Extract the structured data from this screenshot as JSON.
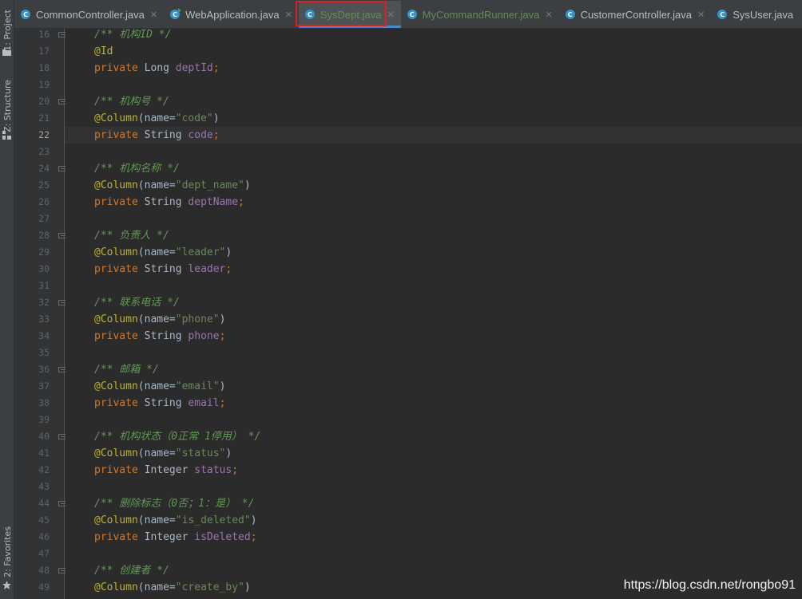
{
  "tool_windows": {
    "project": "1: Project",
    "structure": "Z: Structure",
    "favorites": "2: Favorites"
  },
  "tabs": [
    {
      "label": "CommonController.java",
      "icon": "class-icon",
      "state": "normal"
    },
    {
      "label": "WebApplication.java",
      "icon": "runnable-class-icon",
      "state": "normal"
    },
    {
      "label": "SysDept.java",
      "icon": "class-icon",
      "state": "active"
    },
    {
      "label": "MyCommandRunner.java",
      "icon": "class-icon",
      "state": "green"
    },
    {
      "label": "CustomerController.java",
      "icon": "class-icon",
      "state": "normal"
    },
    {
      "label": "SysUser.java",
      "icon": "class-icon",
      "state": "normal"
    }
  ],
  "editor": {
    "current_line": "22",
    "lines": [
      {
        "n": "16",
        "fold": true,
        "tokens": [
          [
            "comment",
            "/** 机构ID */"
          ]
        ]
      },
      {
        "n": "17",
        "fold": false,
        "tokens": [
          [
            "annot",
            "@Id"
          ]
        ]
      },
      {
        "n": "18",
        "fold": false,
        "tokens": [
          [
            "kw",
            "private "
          ],
          [
            "type",
            "Long "
          ],
          [
            "field",
            "deptId"
          ],
          [
            "punct",
            ";"
          ]
        ]
      },
      {
        "n": "19",
        "fold": false,
        "tokens": []
      },
      {
        "n": "20",
        "fold": true,
        "tokens": [
          [
            "comment",
            "/** 机构号 */"
          ]
        ]
      },
      {
        "n": "21",
        "fold": false,
        "tokens": [
          [
            "annot",
            "@Column"
          ],
          [
            "plain",
            "(name="
          ],
          [
            "str",
            "\"code\""
          ],
          [
            "plain",
            ")"
          ]
        ]
      },
      {
        "n": "22",
        "fold": false,
        "tokens": [
          [
            "kw",
            "private "
          ],
          [
            "type",
            "String "
          ],
          [
            "field",
            "code"
          ],
          [
            "punct",
            ";"
          ]
        ]
      },
      {
        "n": "23",
        "fold": false,
        "tokens": []
      },
      {
        "n": "24",
        "fold": true,
        "tokens": [
          [
            "comment",
            "/** 机构名称 */"
          ]
        ]
      },
      {
        "n": "25",
        "fold": false,
        "tokens": [
          [
            "annot",
            "@Column"
          ],
          [
            "plain",
            "(name="
          ],
          [
            "str",
            "\"dept_name\""
          ],
          [
            "plain",
            ")"
          ]
        ]
      },
      {
        "n": "26",
        "fold": false,
        "tokens": [
          [
            "kw",
            "private "
          ],
          [
            "type",
            "String "
          ],
          [
            "field",
            "deptName"
          ],
          [
            "punct",
            ";"
          ]
        ]
      },
      {
        "n": "27",
        "fold": false,
        "tokens": []
      },
      {
        "n": "28",
        "fold": true,
        "tokens": [
          [
            "comment",
            "/** 负责人 */"
          ]
        ]
      },
      {
        "n": "29",
        "fold": false,
        "tokens": [
          [
            "annot",
            "@Column"
          ],
          [
            "plain",
            "(name="
          ],
          [
            "str",
            "\"leader\""
          ],
          [
            "plain",
            ")"
          ]
        ]
      },
      {
        "n": "30",
        "fold": false,
        "tokens": [
          [
            "kw",
            "private "
          ],
          [
            "type",
            "String "
          ],
          [
            "field",
            "leader"
          ],
          [
            "punct",
            ";"
          ]
        ]
      },
      {
        "n": "31",
        "fold": false,
        "tokens": []
      },
      {
        "n": "32",
        "fold": true,
        "tokens": [
          [
            "comment",
            "/** 联系电话 */"
          ]
        ]
      },
      {
        "n": "33",
        "fold": false,
        "tokens": [
          [
            "annot",
            "@Column"
          ],
          [
            "plain",
            "(name="
          ],
          [
            "str",
            "\"phone\""
          ],
          [
            "plain",
            ")"
          ]
        ]
      },
      {
        "n": "34",
        "fold": false,
        "tokens": [
          [
            "kw",
            "private "
          ],
          [
            "type",
            "String "
          ],
          [
            "field",
            "phone"
          ],
          [
            "punct",
            ";"
          ]
        ]
      },
      {
        "n": "35",
        "fold": false,
        "tokens": []
      },
      {
        "n": "36",
        "fold": true,
        "tokens": [
          [
            "comment",
            "/** 邮箱 */"
          ]
        ]
      },
      {
        "n": "37",
        "fold": false,
        "tokens": [
          [
            "annot",
            "@Column"
          ],
          [
            "plain",
            "(name="
          ],
          [
            "str",
            "\"email\""
          ],
          [
            "plain",
            ")"
          ]
        ]
      },
      {
        "n": "38",
        "fold": false,
        "tokens": [
          [
            "kw",
            "private "
          ],
          [
            "type",
            "String "
          ],
          [
            "field",
            "email"
          ],
          [
            "punct",
            ";"
          ]
        ]
      },
      {
        "n": "39",
        "fold": false,
        "tokens": []
      },
      {
        "n": "40",
        "fold": true,
        "tokens": [
          [
            "comment",
            "/** 机构状态（0正常 1停用） */"
          ]
        ]
      },
      {
        "n": "41",
        "fold": false,
        "tokens": [
          [
            "annot",
            "@Column"
          ],
          [
            "plain",
            "(name="
          ],
          [
            "str",
            "\"status\""
          ],
          [
            "plain",
            ")"
          ]
        ]
      },
      {
        "n": "42",
        "fold": false,
        "tokens": [
          [
            "kw",
            "private "
          ],
          [
            "type",
            "Integer "
          ],
          [
            "field",
            "status"
          ],
          [
            "punct",
            ";"
          ]
        ]
      },
      {
        "n": "43",
        "fold": false,
        "tokens": []
      },
      {
        "n": "44",
        "fold": true,
        "tokens": [
          [
            "comment",
            "/** 删除标志（0否；1：是） */"
          ]
        ]
      },
      {
        "n": "45",
        "fold": false,
        "tokens": [
          [
            "annot",
            "@Column"
          ],
          [
            "plain",
            "(name="
          ],
          [
            "str",
            "\"is_deleted\""
          ],
          [
            "plain",
            ")"
          ]
        ]
      },
      {
        "n": "46",
        "fold": false,
        "tokens": [
          [
            "kw",
            "private "
          ],
          [
            "type",
            "Integer "
          ],
          [
            "field",
            "isDeleted"
          ],
          [
            "punct",
            ";"
          ]
        ]
      },
      {
        "n": "47",
        "fold": false,
        "tokens": []
      },
      {
        "n": "48",
        "fold": true,
        "tokens": [
          [
            "comment",
            "/** 创建者 */"
          ]
        ]
      },
      {
        "n": "49",
        "fold": false,
        "tokens": [
          [
            "annot",
            "@Column"
          ],
          [
            "plain",
            "(name="
          ],
          [
            "str",
            "\"create_by\""
          ],
          [
            "plain",
            ")"
          ]
        ]
      }
    ]
  },
  "watermark": "https://blog.csdn.net/rongbo91",
  "colors": {
    "background": "#2b2b2b",
    "comment": "#629755",
    "annotation": "#bbb529",
    "keyword": "#cc7832",
    "field": "#9876aa",
    "string": "#6a8759",
    "highlight_box": "#e02020"
  }
}
